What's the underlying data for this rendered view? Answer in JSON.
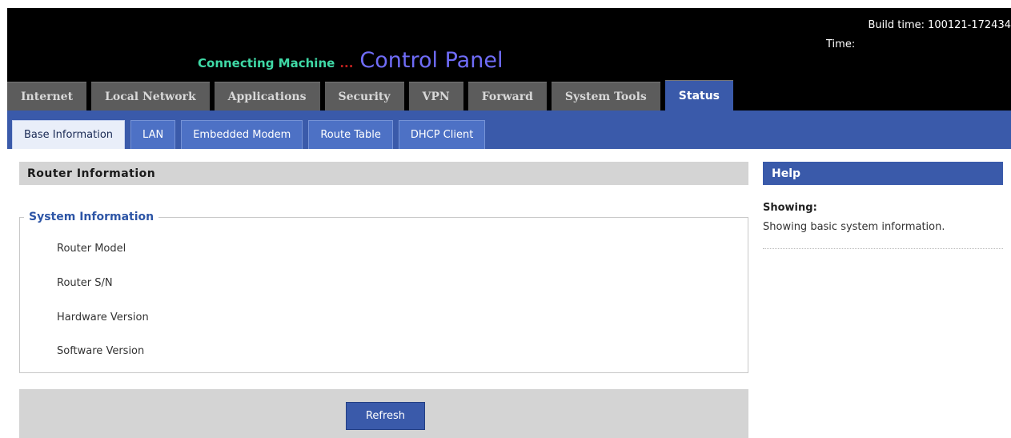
{
  "header": {
    "build_time_label": "Build time:",
    "build_time_value": "100121-172434",
    "time_label": "Time:",
    "brand_machine": "Connecting Machine",
    "brand_dots": "...",
    "brand_panel": "Control Panel"
  },
  "main_tabs": [
    {
      "label": "Internet"
    },
    {
      "label": "Local Network"
    },
    {
      "label": "Applications"
    },
    {
      "label": "Security"
    },
    {
      "label": "VPN"
    },
    {
      "label": "Forward"
    },
    {
      "label": "System Tools"
    },
    {
      "label": "Status",
      "active": true
    }
  ],
  "sub_tabs": [
    {
      "label": "Base Information",
      "active": true
    },
    {
      "label": "LAN"
    },
    {
      "label": "Embedded Modem"
    },
    {
      "label": "Route Table"
    },
    {
      "label": "DHCP Client"
    }
  ],
  "main": {
    "section_title": "Router Information",
    "fieldset_title": "System Information",
    "rows": [
      {
        "label": "Router Model"
      },
      {
        "label": "Router S/N"
      },
      {
        "label": "Hardware Version"
      },
      {
        "label": "Software Version"
      }
    ],
    "refresh_label": "Refresh"
  },
  "help": {
    "title": "Help",
    "showing_label": "Showing:",
    "description": "Showing basic system information."
  },
  "colors": {
    "brand_blue": "#3a5aaa",
    "tab_gray": "#5c5c5c",
    "header_black": "#000000",
    "legend_blue": "#2d55a6"
  }
}
